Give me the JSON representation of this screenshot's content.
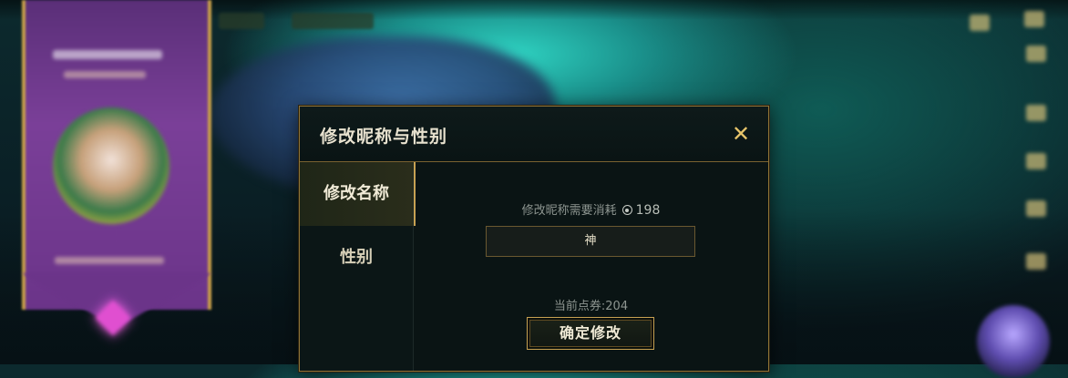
{
  "dialog": {
    "title": "修改昵称与性别",
    "close_icon": "close-icon",
    "tabs": [
      {
        "label": "修改名称",
        "active": true
      },
      {
        "label": "性别",
        "active": false
      }
    ],
    "cost_label": "修改昵称需要消耗",
    "cost_icon": "coin-icon",
    "cost_value": "198",
    "name_value": "神",
    "balance_text": "当前点券:204",
    "confirm_label": "确定修改"
  },
  "theme": {
    "accent_gold": "#c7a152",
    "dialog_bg": "#0a1414",
    "text_light": "#e8e2cf",
    "text_muted": "#8d9590"
  }
}
